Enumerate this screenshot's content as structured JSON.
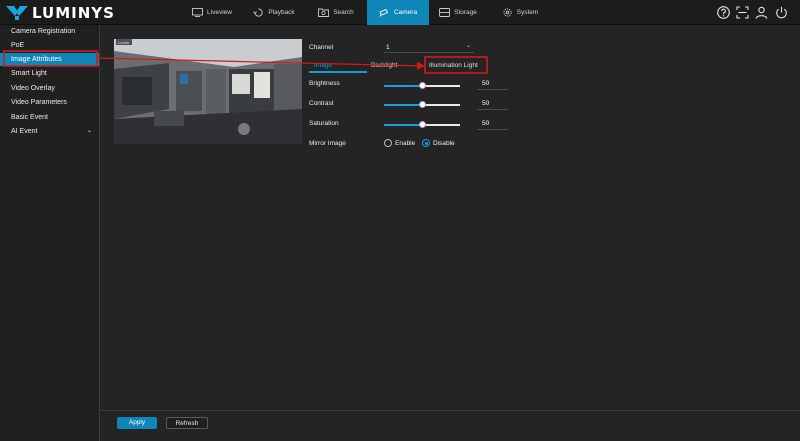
{
  "app": {
    "logo_text": "LUMINYS"
  },
  "nav": {
    "liveview": "Liveview",
    "playback": "Playback",
    "search": "Search",
    "camera": "Camera",
    "storage": "Storage",
    "system": "System"
  },
  "top_icons": [
    "help-icon",
    "scan-icon",
    "user-icon",
    "power-icon"
  ],
  "sidebar": {
    "items": [
      {
        "label": "Camera Registration"
      },
      {
        "label": "PoE"
      },
      {
        "label": "Image Attributes",
        "active": true
      },
      {
        "label": "Smart Light"
      },
      {
        "label": "Video Overlay"
      },
      {
        "label": "Video Parameters"
      },
      {
        "label": "Basic Event"
      },
      {
        "label": "AI Event",
        "expandable": true
      }
    ]
  },
  "preview": {
    "overlay_text": "Lumin"
  },
  "form": {
    "channel_label": "Channel",
    "channel_value": "1",
    "tabs": {
      "image": "Image",
      "backlight": "Backlight",
      "illumination": "Illumination Light"
    },
    "brightness": {
      "label": "Brightness",
      "value": "50"
    },
    "contrast": {
      "label": "Contrast",
      "value": "50"
    },
    "saturation": {
      "label": "Saturation",
      "value": "50"
    },
    "mirror": {
      "label": "Mirror Image",
      "enable": "Enable",
      "disable": "Disable",
      "selected": "Disable"
    }
  },
  "buttons": {
    "apply": "Apply",
    "refresh": "Refresh"
  },
  "colors": {
    "accent": "#0f86b8",
    "annotation": "#d11a1a",
    "background": "#242424"
  }
}
